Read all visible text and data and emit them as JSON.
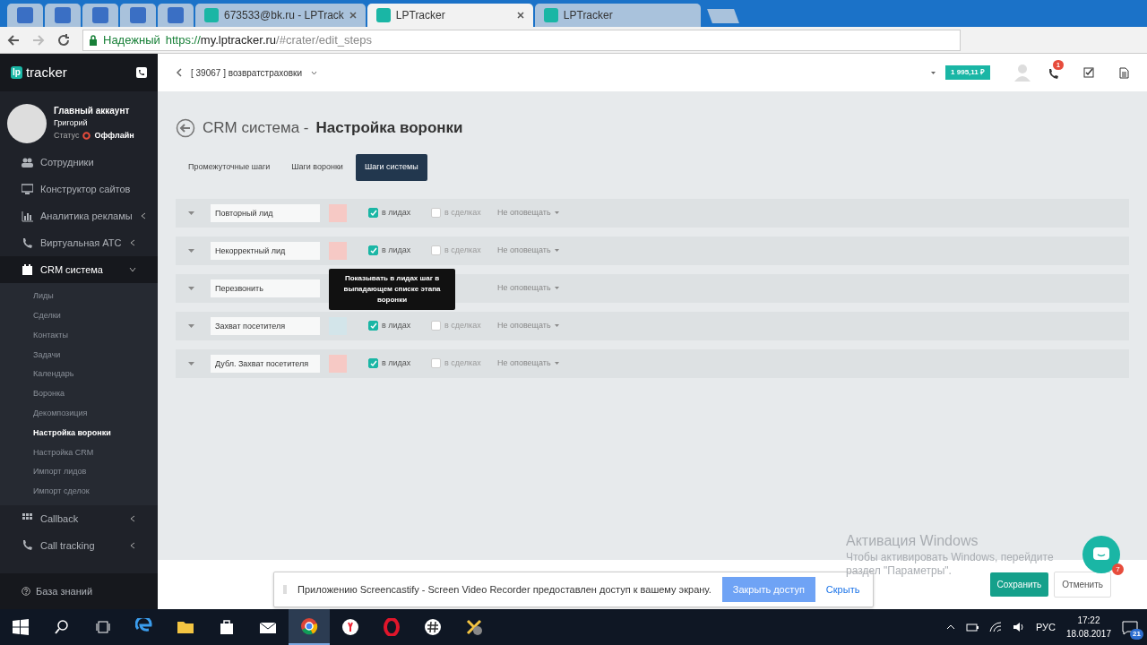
{
  "browser": {
    "tabs": [
      {
        "kind": "pinned",
        "selected": false
      },
      {
        "kind": "pinned",
        "selected": false
      },
      {
        "kind": "pinned",
        "selected": false
      },
      {
        "kind": "pinned",
        "selected": false
      },
      {
        "kind": "pinned",
        "selected": false
      },
      {
        "kind": "page",
        "title": "673533@bk.ru - LPTrack",
        "selected": false
      },
      {
        "kind": "page",
        "title": "LPTracker",
        "selected": true
      },
      {
        "kind": "page",
        "title": "LPTracker",
        "selected": false
      }
    ],
    "secure_label": "Надежный",
    "url_scheme": "https://",
    "url_host": "my.lptracker.ru",
    "url_path": "/#crater/edit_steps"
  },
  "sidebar": {
    "logo_mark": "lp",
    "logo_text": "tracker",
    "user": {
      "name": "Главный аккаунт",
      "login": "Григорий",
      "status_label": "Статус",
      "status": "Оффлайн"
    },
    "items": [
      {
        "label": "Сотрудники",
        "kind": "item"
      },
      {
        "label": "Конструктор сайтов",
        "kind": "item"
      },
      {
        "label": "Аналитика рекламы",
        "kind": "group",
        "expanded": false
      },
      {
        "label": "Виртуальная АТС",
        "kind": "group",
        "expanded": false
      },
      {
        "label": "CRM система",
        "kind": "group",
        "expanded": true,
        "children": [
          {
            "label": "Лиды",
            "selected": false
          },
          {
            "label": "Сделки",
            "selected": false
          },
          {
            "label": "Контакты",
            "selected": false
          },
          {
            "label": "Задачи",
            "selected": false
          },
          {
            "label": "Календарь",
            "selected": false
          },
          {
            "label": "Воронка",
            "selected": false
          },
          {
            "label": "Декомпозиция",
            "selected": false
          },
          {
            "label": "Настройка воронки",
            "selected": true
          },
          {
            "label": "Настройка CRM",
            "selected": false
          },
          {
            "label": "Импорт лидов",
            "selected": false
          },
          {
            "label": "Импорт сделок",
            "selected": false
          }
        ]
      },
      {
        "label": "Callback",
        "kind": "group",
        "expanded": false
      },
      {
        "label": "Call tracking",
        "kind": "group",
        "expanded": false
      }
    ],
    "help": "База знаний"
  },
  "header": {
    "project": "[ 39067 ] возвратстраховки",
    "balance": "1 995,11 ₽",
    "call_count": "1"
  },
  "page": {
    "title_prefix": "CRM система -",
    "title": "Настройка воронки",
    "tabs": [
      {
        "label": "Промежуточные шаги",
        "selected": false
      },
      {
        "label": "Шаги воронки",
        "selected": false
      },
      {
        "label": "Шаги системы",
        "selected": true
      }
    ],
    "steps": [
      {
        "name": "Повторный лид",
        "color": "#f6c9c5",
        "in_leads": true,
        "leads_label": "в лидах",
        "in_deals": false,
        "deals_label": "в сделках",
        "notify": "Не оповещать"
      },
      {
        "name": "Некорректный лид",
        "color": "#f6c9c5",
        "in_leads": true,
        "leads_label": "в лидах",
        "in_deals": false,
        "deals_label": "в сделках",
        "notify": "Не оповещать"
      },
      {
        "name": "Перезвонить",
        "notify": "Не оповещать"
      },
      {
        "name": "Захват посетителя",
        "color": "#d3e5ea",
        "in_leads": true,
        "leads_label": "в лидах",
        "in_deals": false,
        "deals_label": "в сделках",
        "notify": "Не оповещать"
      },
      {
        "name": "Дубл. Захват посетителя",
        "color": "#f6c9c5",
        "in_leads": true,
        "leads_label": "в лидах",
        "in_deals": false,
        "deals_label": "в сделках",
        "notify": "Не оповещать"
      }
    ],
    "tooltip": "Показывать в лидах шаг в выпадающем списке этапа воронки",
    "save": "Сохранить",
    "cancel": "Отменить",
    "chat_count": "7"
  },
  "share_bar": {
    "text": "Приложению Screencastify - Screen Video Recorder предоставлен доступ к вашему экрану.",
    "stop": "Закрыть доступ",
    "hide": "Скрыть"
  },
  "activation": {
    "title": "Активация Windows",
    "line_1": "Чтобы активировать Windows, перейдите",
    "line_2": "раздел \"Параметры\"."
  },
  "taskbar": {
    "apps": [
      {
        "kind": "edge",
        "active": false
      },
      {
        "kind": "folder",
        "active": false
      },
      {
        "kind": "store",
        "active": false
      },
      {
        "kind": "mail",
        "active": false
      },
      {
        "kind": "chrome",
        "active": true
      },
      {
        "kind": "yandex",
        "active": false
      },
      {
        "kind": "opera",
        "active": false
      },
      {
        "kind": "slack",
        "active": false
      },
      {
        "kind": "tool",
        "active": false
      }
    ],
    "language": "РУС",
    "time": "17:22",
    "date": "18.08.2017",
    "notifications": "21"
  }
}
